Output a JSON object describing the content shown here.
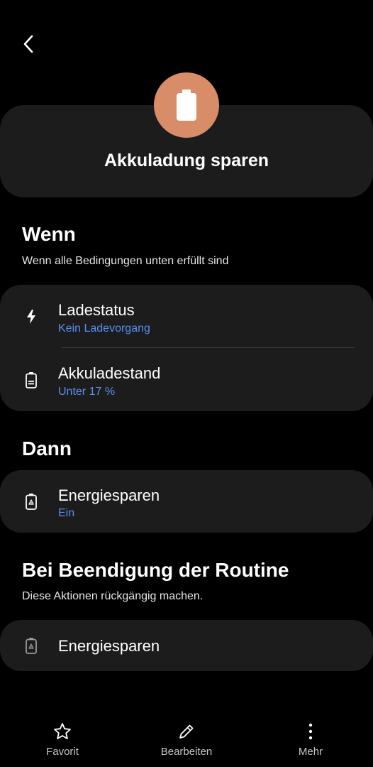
{
  "header": {
    "back_icon": "chevron-left-icon",
    "routine_icon": "battery-icon",
    "routine_icon_color": "#d98c68",
    "title": "Akkuladung sparen"
  },
  "if_section": {
    "title": "Wenn",
    "subtitle": "Wenn alle Bedingungen unten erfüllt sind",
    "items": [
      {
        "icon": "lightning-icon",
        "title": "Ladestatus",
        "value": "Kein Ladevorgang"
      },
      {
        "icon": "battery-level-icon",
        "title": "Akkuladestand",
        "value": "Unter 17 %"
      }
    ]
  },
  "then_section": {
    "title": "Dann",
    "items": [
      {
        "icon": "power-saving-icon",
        "title": "Energiesparen",
        "value": "Ein"
      }
    ]
  },
  "end_section": {
    "title": "Bei Beendigung der Routine",
    "subtitle": "Diese Aktionen rückgängig machen.",
    "items": [
      {
        "icon": "power-saving-icon",
        "title": "Energiesparen"
      }
    ]
  },
  "bottom_nav": {
    "items": [
      {
        "icon": "star-icon",
        "label": "Favorit"
      },
      {
        "icon": "pencil-icon",
        "label": "Bearbeiten"
      },
      {
        "icon": "more-vertical-icon",
        "label": "Mehr"
      }
    ]
  },
  "colors": {
    "background": "#000000",
    "card": "#1c1c1c",
    "accent_text": "#5b8ff0"
  }
}
